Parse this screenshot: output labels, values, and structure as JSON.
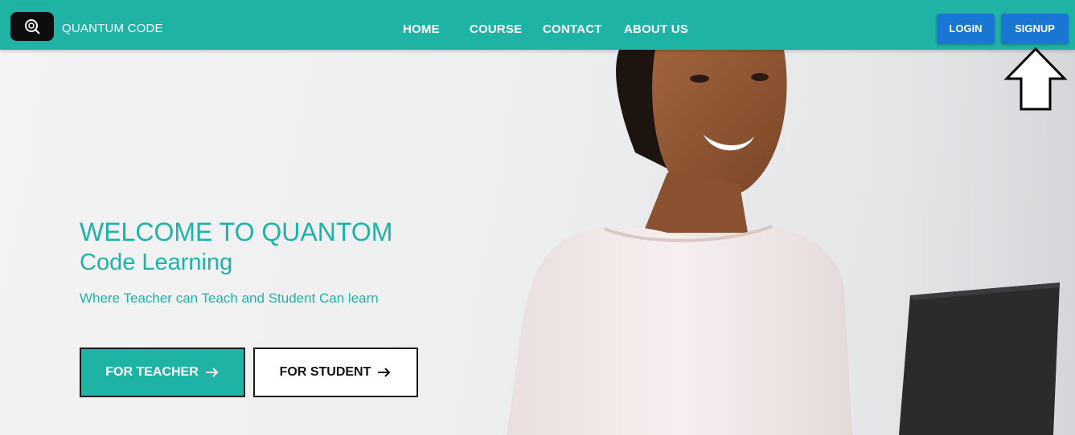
{
  "brand": {
    "name": "QUANTUM CODE",
    "logo_icon": "quantum-q-logo-icon"
  },
  "nav": {
    "links": [
      "HOME",
      "COURSE",
      "CONTACT",
      "ABOUT US"
    ]
  },
  "auth": {
    "login_label": "LOGIN",
    "signup_label": "SIGNUP"
  },
  "hero": {
    "title_line1": "WELCOME TO QUANTOM",
    "title_line2": "Code Learning",
    "subtitle": "Where Teacher can Teach and Student Can learn",
    "teacher_button": "FOR TEACHER",
    "student_button": "FOR STUDENT",
    "image_description_icon": "smiling-woman-with-laptop-photo"
  },
  "colors": {
    "teal": "#1fb3a6",
    "blue_button": "#1976d2",
    "text_teal": "#20b2a6"
  }
}
